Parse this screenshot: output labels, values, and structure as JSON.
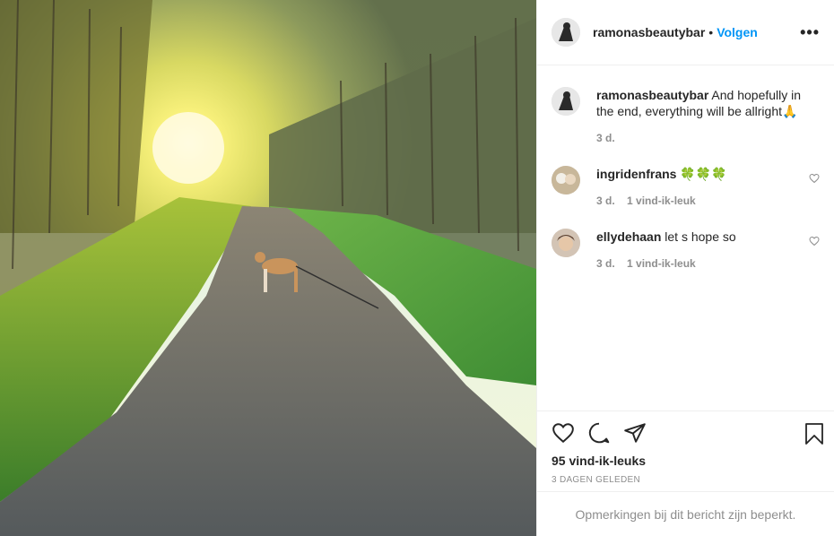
{
  "post": {
    "author": "ramonasbeautybar",
    "separator": "•",
    "follow_label": "Volgen",
    "more_label": "•••",
    "caption": {
      "user": "ramonasbeautybar",
      "text": "And hopefully in the end, everything will be allright🙏",
      "time": "3 d."
    },
    "comments": [
      {
        "user": "ingridenfrans",
        "text": "🍀🍀🍀",
        "time": "3 d.",
        "likes": "1 vind-ik-leuk"
      },
      {
        "user": "ellydehaan",
        "text": "let s hope so",
        "time": "3 d.",
        "likes": "1 vind-ik-leuk"
      }
    ],
    "like_count": "95 vind-ik-leuks",
    "posted_ago": "3 DAGEN GELEDEN",
    "comments_limited": "Opmerkingen bij dit bericht zijn beperkt."
  },
  "colors": {
    "accent": "#0095f6",
    "muted": "#8e8e8e",
    "text": "#262626",
    "border": "#efefef"
  },
  "icons": [
    "heart-icon",
    "comment-icon",
    "share-icon",
    "bookmark-icon",
    "more-icon",
    "small-heart-icon"
  ]
}
